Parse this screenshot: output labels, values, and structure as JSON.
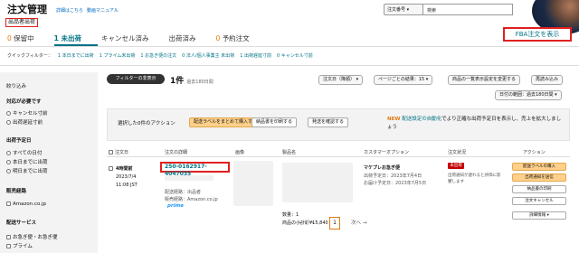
{
  "header": {
    "title": "注文管理",
    "links": [
      "詳細はこちら",
      "動画マニュアル"
    ],
    "seller_badge": "出品者出荷",
    "search_select": "注文番号",
    "search_placeholder": "検索"
  },
  "tabs": [
    {
      "count": "0",
      "label": "保留中"
    },
    {
      "count": "1",
      "label": "未出荷"
    },
    {
      "count": "",
      "label": "キャンセル済み"
    },
    {
      "count": "",
      "label": "出荷済み"
    },
    {
      "count": "0",
      "label": "予約注文"
    }
  ],
  "fba_button": "FBA注文を表示",
  "quick_filters": {
    "label": "クイックフィルター：",
    "items": [
      "1 本日までに出荷",
      "1 プライム未出荷",
      "1 お急ぎ便の注文",
      "0 法人/個人事業主 未出荷",
      "1 出荷遅延寸前",
      "0 キャンセル寸前"
    ]
  },
  "sidebar": {
    "title": "絞り込み",
    "sections": [
      {
        "heading": "対応が必要です",
        "options": [
          "キャンセル寸前",
          "出荷遅延寸前"
        ],
        "kind": "radio"
      },
      {
        "heading": "出荷予定日",
        "options": [
          "すべての日付",
          "本日までに出荷",
          "明日までに出荷"
        ],
        "kind": "radio"
      },
      {
        "heading": "販売経路",
        "options": [
          "Amazon.co.jp"
        ],
        "kind": "check"
      },
      {
        "heading": "配送サービス",
        "options": [
          "お急ぎ便・お急ぎ便",
          "プライム"
        ],
        "kind": "check"
      }
    ]
  },
  "toolbar": {
    "filter_toggle": "フィルターの非表示",
    "count": "1件",
    "count_note": "過去180日間",
    "sort": "注文日（降順）",
    "per_page": "ページごとの結果：15",
    "settings": "商品の一覧表示設定を変更する",
    "refresh": "再読み込み",
    "date_range": "日付の範囲：過去180日間"
  },
  "action_bar": {
    "selected_text": "選択した0件のアクション",
    "bulk_buy_label": "配送ラベルをまとめて購入する",
    "print_slip": "納品書を印刷する",
    "confirm_ship": "発送を確認する",
    "new_tag": "NEW",
    "new_link": "配送設定の自動化",
    "new_text": "でより正確な出荷予定日を表示し、売上を拡大しましょう"
  },
  "table": {
    "headers": [
      "注文日",
      "注文の詳細",
      "画像",
      "製品名",
      "カスタマーオプション",
      "注文状況",
      "アクション"
    ],
    "row": {
      "age": "4時間前",
      "date": "2023/7/4",
      "time": "11:08 JST",
      "order_id": "250-0162917-4047035",
      "ship_method_label": "配送経路：出品者",
      "sales_channel": "販売経路：Amazon.co.jp",
      "prime": "prime",
      "qty": "数量：1",
      "subtotal": "商品の小計：¥15,840",
      "customer_option": "マケプレお急ぎ便",
      "ship_by": "出荷予定日：2023年7月4日",
      "deliver_by": "お届け予定日：2023年7月5日",
      "status_badge": "未出荷 (1)",
      "status_text": "出荷通知が遅れると評価に影響します",
      "actions": [
        "配送ラベルの購入",
        "出荷通知を送信",
        "納品書の印刷",
        "注文キャンセル"
      ],
      "more": "詳細情報"
    }
  },
  "pager": {
    "prev": "← 前へ",
    "page": "1",
    "next": "次へ →"
  }
}
